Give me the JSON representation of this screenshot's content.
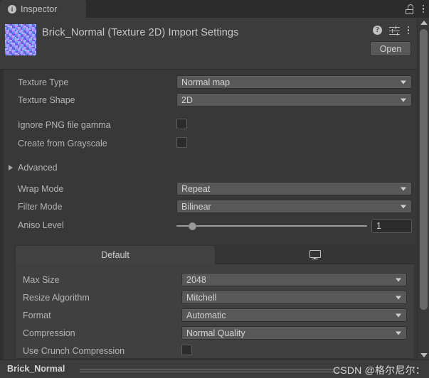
{
  "window": {
    "tab": {
      "label": "Inspector",
      "icon": "info-icon"
    },
    "lock_icon": "lock-icon",
    "menu_icon": "kebab-menu-icon"
  },
  "header": {
    "title": "Brick_Normal (Texture 2D) Import Settings",
    "thumbnail_alt": "brick-normal-map-thumbnail",
    "help_icon": "help-icon",
    "preset_icon": "preset-icon",
    "menu_icon": "kebab-menu-icon",
    "open_label": "Open"
  },
  "properties": [
    {
      "label": "Texture Type",
      "type": "dropdown",
      "value": "Normal map"
    },
    {
      "label": "Texture Shape",
      "type": "dropdown",
      "value": "2D"
    },
    {
      "label": "Ignore PNG file gamma",
      "type": "checkbox",
      "value": false
    },
    {
      "label": "Create from Grayscale",
      "type": "checkbox",
      "value": false
    }
  ],
  "advanced": {
    "label": "Advanced",
    "expanded": false
  },
  "advanced_properties": [
    {
      "label": "Wrap Mode",
      "type": "dropdown",
      "value": "Repeat"
    },
    {
      "label": "Filter Mode",
      "type": "dropdown",
      "value": "Bilinear"
    },
    {
      "label": "Aniso Level",
      "type": "slider",
      "value": "1",
      "min": 0,
      "max": 16
    }
  ],
  "platform": {
    "tabs": [
      {
        "label": "Default",
        "active": true
      },
      {
        "label": "",
        "icon": "monitor-icon",
        "active": false
      }
    ],
    "properties": [
      {
        "label": "Max Size",
        "type": "dropdown",
        "value": "2048"
      },
      {
        "label": "Resize Algorithm",
        "type": "dropdown",
        "value": "Mitchell"
      },
      {
        "label": "Format",
        "type": "dropdown",
        "value": "Automatic"
      },
      {
        "label": "Compression",
        "type": "dropdown",
        "value": "Normal Quality"
      },
      {
        "label": "Use Crunch Compression",
        "type": "checkbox",
        "value": false
      }
    ]
  },
  "footer": {
    "asset_name": "Brick_Normal",
    "watermark": "CSDN @格尔尼尔："
  },
  "colors": {
    "panel_bg": "#383838",
    "header_bg": "#3c3c3c",
    "tabbar_bg": "#2c2c2c",
    "control_bg": "#585858",
    "field_bg": "#2b2b2b",
    "text": "#b4b4b4",
    "value_text": "#d2d2d2"
  }
}
